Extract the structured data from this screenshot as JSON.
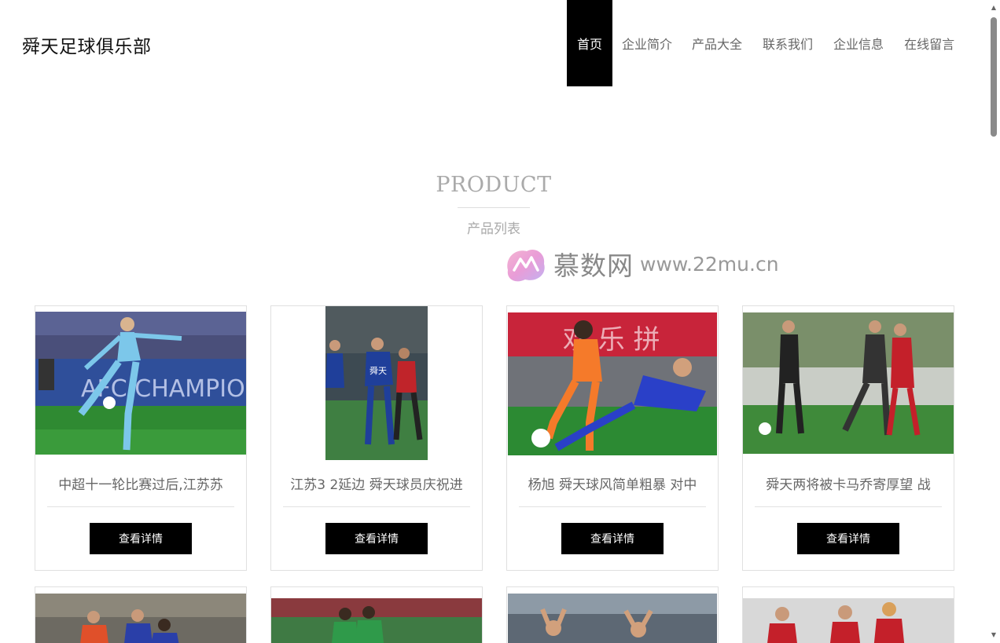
{
  "header": {
    "site_title": "舜天足球俱乐部",
    "nav": [
      "首页",
      "企业简介",
      "产品大全",
      "联系我们",
      "企业信息",
      "在线留言"
    ],
    "active_index": 0
  },
  "section": {
    "title": "PRODUCT",
    "subtitle": "产品列表"
  },
  "watermark": {
    "name": "慕数网",
    "url": "www.22mu.cn"
  },
  "products": [
    {
      "title": "中超十一轮比赛过后,江苏苏",
      "button": "查看详情"
    },
    {
      "title": "江苏3 2延边 舜天球员庆祝进",
      "button": "查看详情"
    },
    {
      "title": "杨旭 舜天球风简单粗暴 对中",
      "button": "查看详情"
    },
    {
      "title": "舜天两将被卡马乔寄厚望 战",
      "button": "查看详情"
    }
  ],
  "photo_captions": {
    "banner_text": "AFC CHAMPIONS LI",
    "jersey_text": "舜天",
    "board_text": "欢 乐 拼"
  },
  "colors": {
    "nav_active_bg": "#000000",
    "button_bg": "#000000",
    "heading": "#aaaaaa"
  }
}
